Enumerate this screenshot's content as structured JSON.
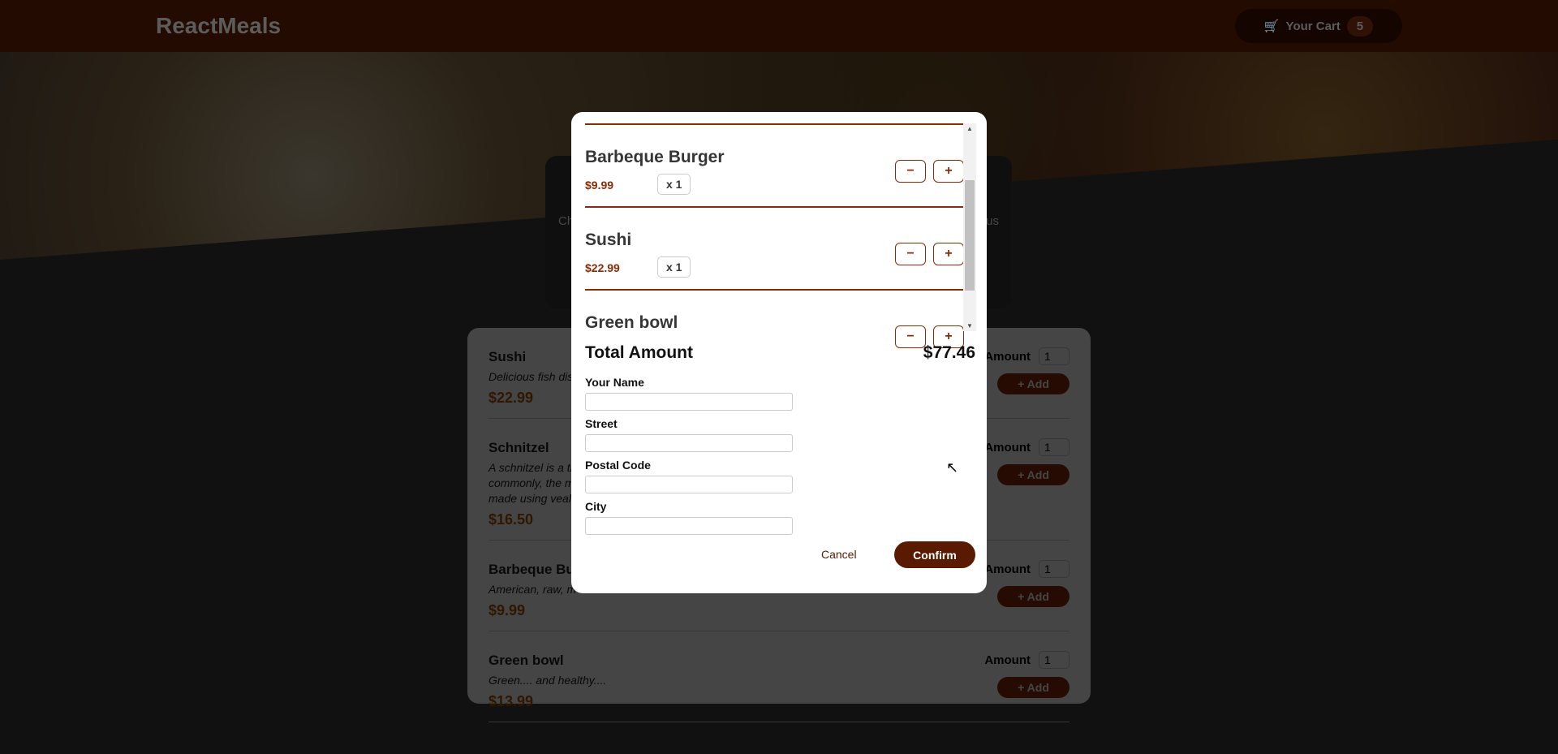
{
  "header": {
    "title": "ReactMeals",
    "cart_label": "Your Cart",
    "cart_count": "5",
    "cart_icon": "shopping-cart-icon"
  },
  "summary": {
    "left_fragment": "Ch",
    "right_fragment": "ous"
  },
  "menu": {
    "amount_label": "Amount",
    "add_label": "+ Add",
    "items": [
      {
        "name": "Sushi",
        "description": "Delicious fish dis",
        "price": "$22.99",
        "amount": "1"
      },
      {
        "name": "Schnitzel",
        "description": "A schnitzel is a th\ncommonly, the m\nmade using veal,",
        "price": "$16.50",
        "amount": "1"
      },
      {
        "name": "Barbeque Burger",
        "description": "American, raw, m",
        "price": "$9.99",
        "amount": "1"
      },
      {
        "name": "Green bowl",
        "description": "Green.... and healthy....",
        "price": "$13.99",
        "amount": "1"
      }
    ]
  },
  "cart": {
    "items": [
      {
        "name": "Barbeque Burger",
        "price": "$9.99",
        "qty": "x 1"
      },
      {
        "name": "Sushi",
        "price": "$22.99",
        "qty": "x 1"
      },
      {
        "name": "Green bowl",
        "price": "",
        "qty": ""
      }
    ],
    "minus": "−",
    "plus": "+",
    "total_label": "Total Amount",
    "total_value": "$77.46"
  },
  "form": {
    "name_label": "Your Name",
    "street_label": "Street",
    "postal_label": "Postal Code",
    "city_label": "City",
    "name": "",
    "street": "",
    "postal": "",
    "city": "",
    "cancel": "Cancel",
    "confirm": "Confirm"
  },
  "colors": {
    "brand": "#8a2b06",
    "confirm": "#5a1a01",
    "price": "#ad5502"
  }
}
